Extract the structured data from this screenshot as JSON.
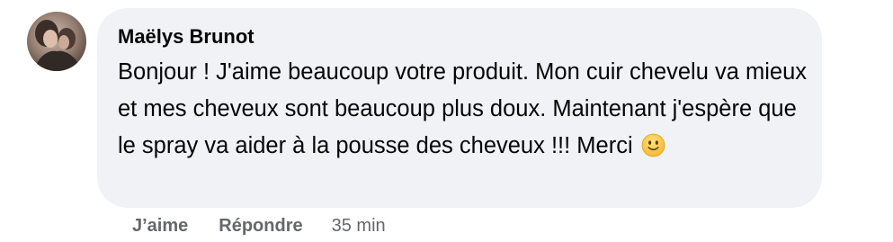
{
  "comment": {
    "author": "Maëlys Brunot",
    "text": "Bonjour ! J'aime beaucoup votre produit. Mon cuir chevelu va mieux et mes cheveux sont beaucoup plus doux. Maintenant j'espère que le spray va aider à la pousse des cheveux !!! Merci",
    "emoji": "slightly-smiling-face-icon",
    "actions": {
      "like_label": "J’aime",
      "reply_label": "Répondre",
      "timestamp": "35 min"
    }
  },
  "colors": {
    "bubble_background": "#f0f2f5",
    "text": "#050505",
    "secondary_text": "#65676b",
    "emoji_face": "#f7c948"
  }
}
